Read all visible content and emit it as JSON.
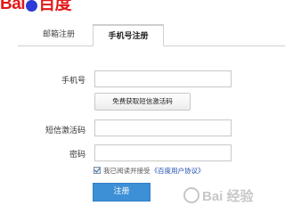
{
  "logo": {
    "text_left": "Bai",
    "text_right": "百度"
  },
  "tabs": [
    {
      "label": "邮箱注册"
    },
    {
      "label": "手机号注册"
    }
  ],
  "form": {
    "phone_label": "手机号",
    "phone_value": "",
    "sms_button_label": "免费获取短信激活码",
    "code_label": "短信激活码",
    "code_value": "",
    "password_label": "密码",
    "password_value": "",
    "agree_text": "我已阅读并接受",
    "agree_link": "《百度用户协议》",
    "agree_checked": true,
    "submit_label": "注册"
  },
  "watermark": {
    "text": "Bai 经验"
  },
  "colors": {
    "brand_red": "#e21918",
    "brand_blue": "#2a3bd6",
    "submit_blue": "#3d8fd6",
    "link_blue": "#1f4eb0"
  }
}
